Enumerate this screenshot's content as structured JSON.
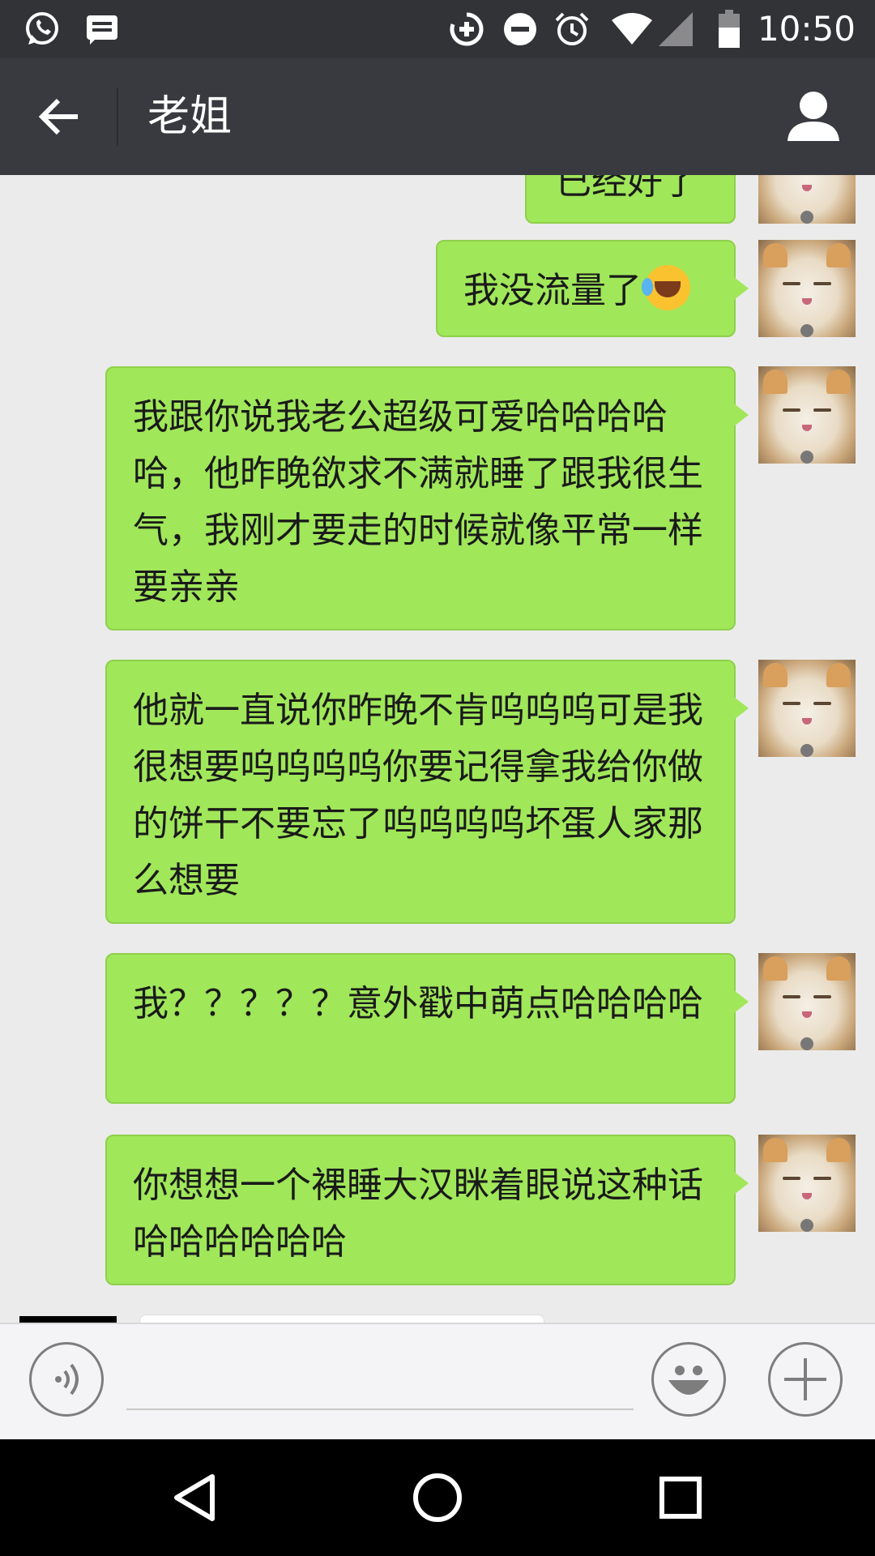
{
  "status_bar": {
    "time": "10:50",
    "left_icons": [
      "whatsapp-icon",
      "message-icon"
    ],
    "right_icons": [
      "data-saver-icon",
      "do-not-disturb-icon",
      "alarm-icon",
      "wifi-icon",
      "cell-signal-icon",
      "battery-icon"
    ]
  },
  "header": {
    "title": "老姐",
    "back_icon": "arrow-left-icon",
    "profile_icon": "person-icon"
  },
  "messages": [
    {
      "sender": "me",
      "text": "已经好了"
    },
    {
      "sender": "me",
      "text": "我没流量了",
      "emoji": "rolling-laughing-emoji"
    },
    {
      "sender": "me",
      "text": "我跟你说我老公超级可爱哈哈哈哈哈，他昨晚欲求不满就睡了跟我很生气，我刚才要走的时候就像平常一样要亲亲"
    },
    {
      "sender": "me",
      "text": "他就一直说你昨晚不肯呜呜呜可是我很想要呜呜呜呜你要记得拿我给你做的饼干不要忘了呜呜呜呜坏蛋人家那么想要"
    },
    {
      "sender": "me",
      "text": "我？？？？？意外戳中萌点哈哈哈哈"
    },
    {
      "sender": "me",
      "text": "你想想一个裸睡大汉眯着眼说这种话哈哈哈哈哈哈"
    }
  ],
  "input_bar": {
    "voice_icon": "voice-icon",
    "emoji_icon": "smiley-icon",
    "more_icon": "plus-icon",
    "input_value": ""
  },
  "nav_bar": {
    "icons": [
      "back-triangle-icon",
      "home-circle-icon",
      "recents-square-icon"
    ]
  }
}
